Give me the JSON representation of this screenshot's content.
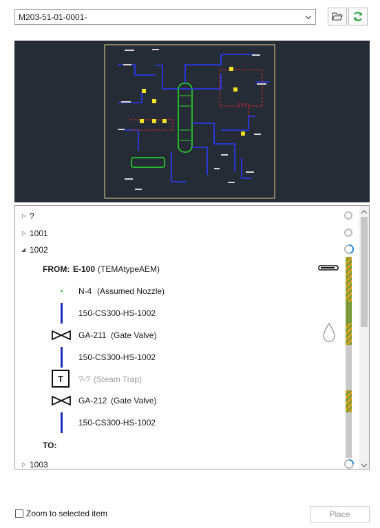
{
  "drawing_select": {
    "value": "M203-51-01-0001-"
  },
  "tree": {
    "nodes": [
      {
        "label": "?"
      },
      {
        "label": "1001"
      },
      {
        "label": "1002"
      },
      {
        "label": "1003"
      }
    ],
    "route": {
      "from_prefix": "FROM:",
      "from_tag": "E-100",
      "from_type": "(TEMAtypeAEM)",
      "items": [
        {
          "tag": "N-4",
          "desc": "(Assumed Nozzle)"
        },
        {
          "tag": "150-CS300-HS-1002",
          "desc": ""
        },
        {
          "tag": "GA-211",
          "desc": "(Gate Valve)"
        },
        {
          "tag": "150-CS300-HS-1002",
          "desc": ""
        },
        {
          "tag": "?-?",
          "desc": "(Steam Trap)",
          "symbol": "T"
        },
        {
          "tag": "GA-212",
          "desc": "(Gate Valve)"
        },
        {
          "tag": "150-CS300-HS-1002",
          "desc": ""
        }
      ],
      "to_label": "TO:"
    }
  },
  "footer": {
    "zoom_label": "Zoom to selected item",
    "zoom_checked": false,
    "place_label": "Place"
  },
  "colors": {
    "pipe_blue": "#1a2bc0",
    "hatch_orange": "#d9a21f",
    "hatch_green": "#7a9a3a",
    "loading_blue": "#2a8fd6",
    "refresh_green": "#1ea33a"
  }
}
